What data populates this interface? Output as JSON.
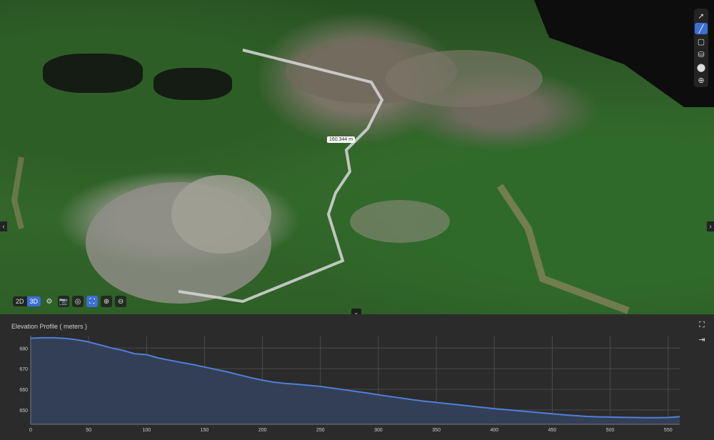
{
  "viewer": {
    "distance_label": "160.344 m",
    "mode_2d": "2D",
    "mode_3d": "3D",
    "right_tools": [
      "pointer-icon",
      "line-measure-icon",
      "area-measure-icon",
      "volume-icon",
      "marker-icon",
      "target-icon"
    ],
    "bottom_tools": [
      "settings-icon",
      "camera-icon",
      "orbit-icon",
      "fit-icon",
      "zoom-in-icon",
      "zoom-out-icon"
    ]
  },
  "profile": {
    "title": "Elevation Profile ( meters )"
  },
  "chart_data": {
    "type": "area",
    "title": "Elevation Profile ( meters )",
    "xlabel": "",
    "ylabel": "",
    "xlim": [
      0,
      560
    ],
    "ylim": [
      643,
      686
    ],
    "xticks": [
      0,
      50,
      100,
      150,
      200,
      250,
      300,
      350,
      400,
      450,
      500,
      550
    ],
    "yticks": [
      650,
      660,
      670,
      680
    ],
    "grid": true,
    "color": "#4f80d8",
    "fill": "#34405a",
    "x": [
      0,
      10,
      20,
      30,
      40,
      50,
      60,
      70,
      80,
      90,
      100,
      110,
      120,
      130,
      140,
      150,
      160,
      170,
      180,
      190,
      200,
      210,
      220,
      230,
      240,
      250,
      260,
      270,
      280,
      290,
      300,
      310,
      320,
      330,
      340,
      350,
      360,
      370,
      380,
      390,
      400,
      410,
      420,
      430,
      440,
      450,
      460,
      470,
      480,
      490,
      500,
      510,
      520,
      530,
      540,
      550,
      560
    ],
    "y": [
      684.8,
      685,
      685,
      684.7,
      684,
      683,
      681.5,
      680,
      678.8,
      677.2,
      676.8,
      675.2,
      674.1,
      673,
      672,
      670.8,
      669.6,
      668.4,
      667,
      665.6,
      664.4,
      663.4,
      662.8,
      662.4,
      661.9,
      661.4,
      660.6,
      659.8,
      659,
      658.2,
      657.3,
      656.5,
      655.7,
      654.9,
      654.2,
      653.6,
      653,
      652.4,
      651.8,
      651.2,
      650.6,
      650.1,
      649.6,
      649.1,
      648.6,
      648.1,
      647.6,
      647.2,
      646.8,
      646.6,
      646.5,
      646.4,
      646.3,
      646.2,
      646.2,
      646.3,
      646.7
    ]
  }
}
